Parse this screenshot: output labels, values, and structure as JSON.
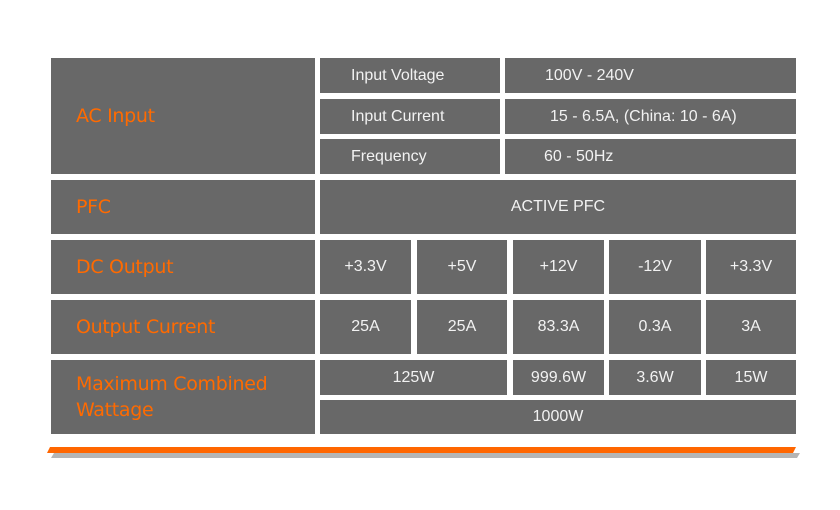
{
  "colors": {
    "cell_bg": "#686868",
    "header_text": "#ff6a00",
    "value_text": "#f2f2f2",
    "accent_bar": "#ff6600",
    "shadow_bar": "#b5b5b5"
  },
  "ac_input": {
    "header": "AC Input",
    "rows": [
      {
        "label": "Input Voltage",
        "value": "100V - 240V"
      },
      {
        "label": "Input Current",
        "value": "15 - 6.5A, (China: 10 - 6A)"
      },
      {
        "label": "Frequency",
        "value": "60 - 50Hz"
      }
    ]
  },
  "pfc": {
    "header": "PFC",
    "value": "ACTIVE PFC"
  },
  "dc_output": {
    "header": "DC Output",
    "values": [
      "+3.3V",
      "+5V",
      "+12V",
      "-12V",
      "+3.3V"
    ]
  },
  "output_current": {
    "header": "Output Current",
    "values": [
      "25A",
      "25A",
      "83.3A",
      "0.3A",
      "3A"
    ]
  },
  "max_wattage": {
    "header": "Maximum Combined Wattage",
    "values": [
      "125W",
      "999.6W",
      "3.6W",
      "15W"
    ],
    "total": "1000W"
  }
}
